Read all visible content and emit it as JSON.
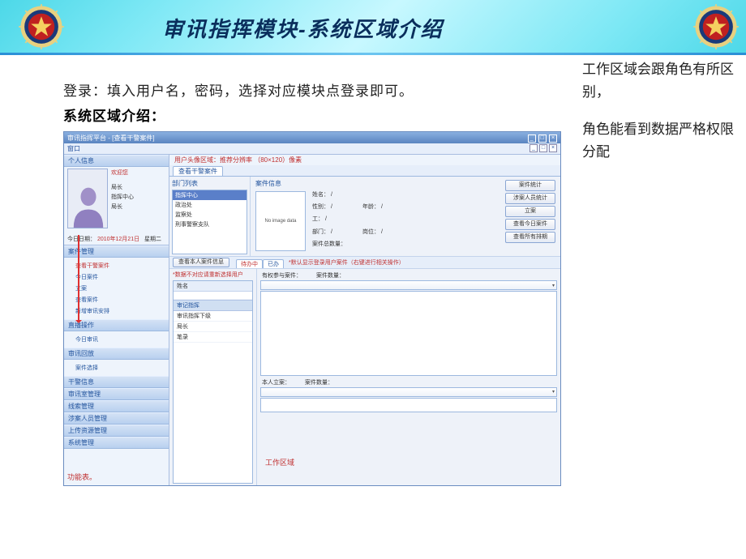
{
  "banner": {
    "title": "审讯指挥模块-系统区域介绍"
  },
  "description": {
    "line1": "登录：填入用户名，密码，选择对应模块点登录即可。",
    "line2": "系统区域介绍："
  },
  "side_note": {
    "p1": "工作区域会跟角色有所区别，",
    "p2": "角色能看到数据严格权限分配"
  },
  "app": {
    "titlebar": "审讯指挥平台 - [查看干警案件]",
    "menubar_item": "窗口",
    "avatar_zone_annot": "用户头像区域：推荐分辨率 （80×120）像素",
    "personal_info": {
      "header": "个人信息",
      "welcome": "欢迎您",
      "user_rank": "局长",
      "user_dept": "指挥中心",
      "user_role": "局长",
      "date_label": "今日日期：",
      "date_value": "2010年12月21日",
      "weekday": "星期二"
    },
    "left_nav": {
      "case_mgmt": "案件管理",
      "items_case": [
        "查看干警案件",
        "今日案件",
        "立案",
        "查看案件",
        "新增审讯安排"
      ],
      "live_ops": "直播操作",
      "items_live": [
        "今日审讯"
      ],
      "review": "审讯回放",
      "items_review": [
        "案件选择"
      ],
      "police_info": "干警信息",
      "room_mgmt": "审讯室管理",
      "clue_mgmt": "线索管理",
      "suspect_mgmt": "涉案人员管理",
      "upload_mgmt": "上传资源管理",
      "sys_mgmt": "系统管理",
      "bottom_annot": "功能表。"
    },
    "main": {
      "tab": "查看干警案件",
      "dept_list_label": "部门列表",
      "dept_items": [
        "指挥中心",
        "政治处",
        "监察处",
        "刑事警察支队"
      ],
      "case_info_label": "案件信息",
      "no_image": "No image data",
      "fields": {
        "name": "姓名：  /",
        "gender": "性别：  /",
        "age": "年龄：  /",
        "work": "工：  /",
        "dept": "部门：  /",
        "position": "岗位：  /",
        "total": "案件总数量："
      },
      "btns": {
        "stat": "案件统计",
        "suspect_stat": "涉案人员统计",
        "create": "立案",
        "today": "查看今日案件",
        "all": "查看所有排期"
      },
      "view_self_btn": "查看本人案件信息",
      "subtabs": {
        "pending": "待办中",
        "done": "已办"
      },
      "subtab_hint": "*默认显示登录用户案件（右键进行相关操作）",
      "user_warn": "*数据不对应请重新选择用户",
      "user_col_header": "姓名",
      "user_rows_section": "审记指挥",
      "user_rows": [
        "审讯指挥下级",
        "局长",
        "笔录"
      ],
      "participate_label": "有权参与案件：",
      "case_count_label": "案件数量：",
      "self_case_label": "本人立案：",
      "work_area_label": "工作区域"
    }
  }
}
